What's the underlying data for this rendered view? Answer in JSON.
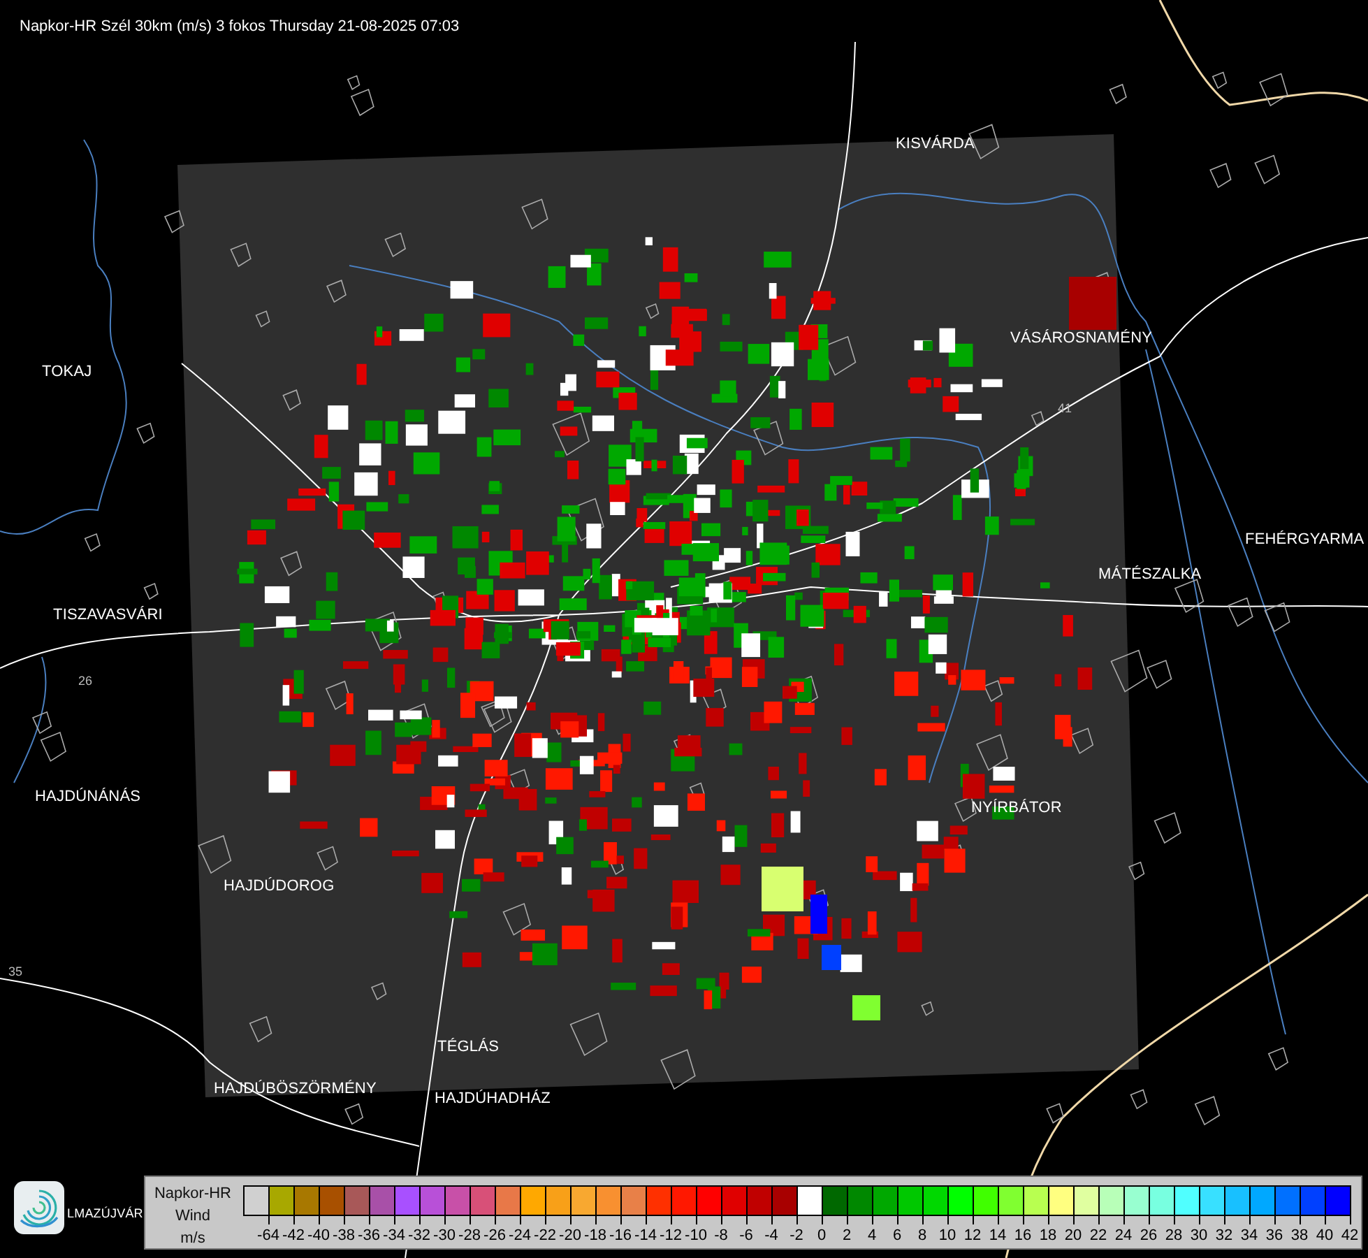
{
  "title": "Napkor-HR Szél 30km (m/s) 3 fokos Thursday 21-08-2025 07:03",
  "map": {
    "places": [
      {
        "name": "KISVÁRDA"
      },
      {
        "name": "VÁSÁROSNAMÉNY"
      },
      {
        "name": "TOKAJ"
      },
      {
        "name": "FEHÉRGYARMA"
      },
      {
        "name": "MÁTÉSZALKA"
      },
      {
        "name": "TISZAVASVÁRI"
      },
      {
        "name": "HAJDÚNÁNÁS"
      },
      {
        "name": "NYÍRBÁTOR"
      },
      {
        "name": "HAJDÚDOROG"
      },
      {
        "name": "TÉGLÁS"
      },
      {
        "name": "HAJDÚBÖSZÖRMÉNY"
      },
      {
        "name": "HAJDÚHADHÁZ"
      },
      {
        "name": "LMAZÚJVÁR"
      }
    ],
    "road_numbers": [
      "41",
      "26",
      "35"
    ]
  },
  "legend": {
    "source": "Napkor-HR",
    "quantity": "Wind",
    "unit": "m/s",
    "swatches": [
      {
        "color": "#d0d0d0"
      },
      {
        "color": "#a8a800"
      },
      {
        "color": "#a87800"
      },
      {
        "color": "#a85000"
      },
      {
        "color": "#a85858"
      },
      {
        "color": "#a850a8"
      },
      {
        "color": "#a850ff"
      },
      {
        "color": "#b850d8"
      },
      {
        "color": "#c850a8"
      },
      {
        "color": "#d85078"
      },
      {
        "color": "#e87848"
      },
      {
        "color": "#ffa800"
      },
      {
        "color": "#f8a018"
      },
      {
        "color": "#f8a830"
      },
      {
        "color": "#f89030"
      },
      {
        "color": "#e88048"
      },
      {
        "color": "#ff3000"
      },
      {
        "color": "#ff1800"
      },
      {
        "color": "#ff0000"
      },
      {
        "color": "#e00000"
      },
      {
        "color": "#c00000"
      },
      {
        "color": "#a80000"
      },
      {
        "color": "#ffffff"
      },
      {
        "color": "#006800"
      },
      {
        "color": "#008800"
      },
      {
        "color": "#00a800"
      },
      {
        "color": "#00c800"
      },
      {
        "color": "#00d800"
      },
      {
        "color": "#00ff00"
      },
      {
        "color": "#40ff00"
      },
      {
        "color": "#80ff30"
      },
      {
        "color": "#b8ff50"
      },
      {
        "color": "#ffff80"
      },
      {
        "color": "#e0ffa0"
      },
      {
        "color": "#b8ffb8"
      },
      {
        "color": "#98ffd0"
      },
      {
        "color": "#78ffe0"
      },
      {
        "color": "#50ffff"
      },
      {
        "color": "#38e0ff"
      },
      {
        "color": "#18c0ff"
      },
      {
        "color": "#00a8ff"
      },
      {
        "color": "#0070ff"
      },
      {
        "color": "#0040ff"
      },
      {
        "color": "#0000ff"
      }
    ],
    "ticks": [
      "-64",
      "-42",
      "-40",
      "-38",
      "-36",
      "-34",
      "-32",
      "-30",
      "-28",
      "-26",
      "-24",
      "-22",
      "-20",
      "-18",
      "-16",
      "-14",
      "-12",
      "-10",
      "-8",
      "-6",
      "-4",
      "-2",
      "0",
      "2",
      "4",
      "6",
      "8",
      "10",
      "12",
      "14",
      "16",
      "18",
      "20",
      "22",
      "24",
      "26",
      "28",
      "30",
      "32",
      "34",
      "36",
      "38",
      "40",
      "42"
    ]
  }
}
